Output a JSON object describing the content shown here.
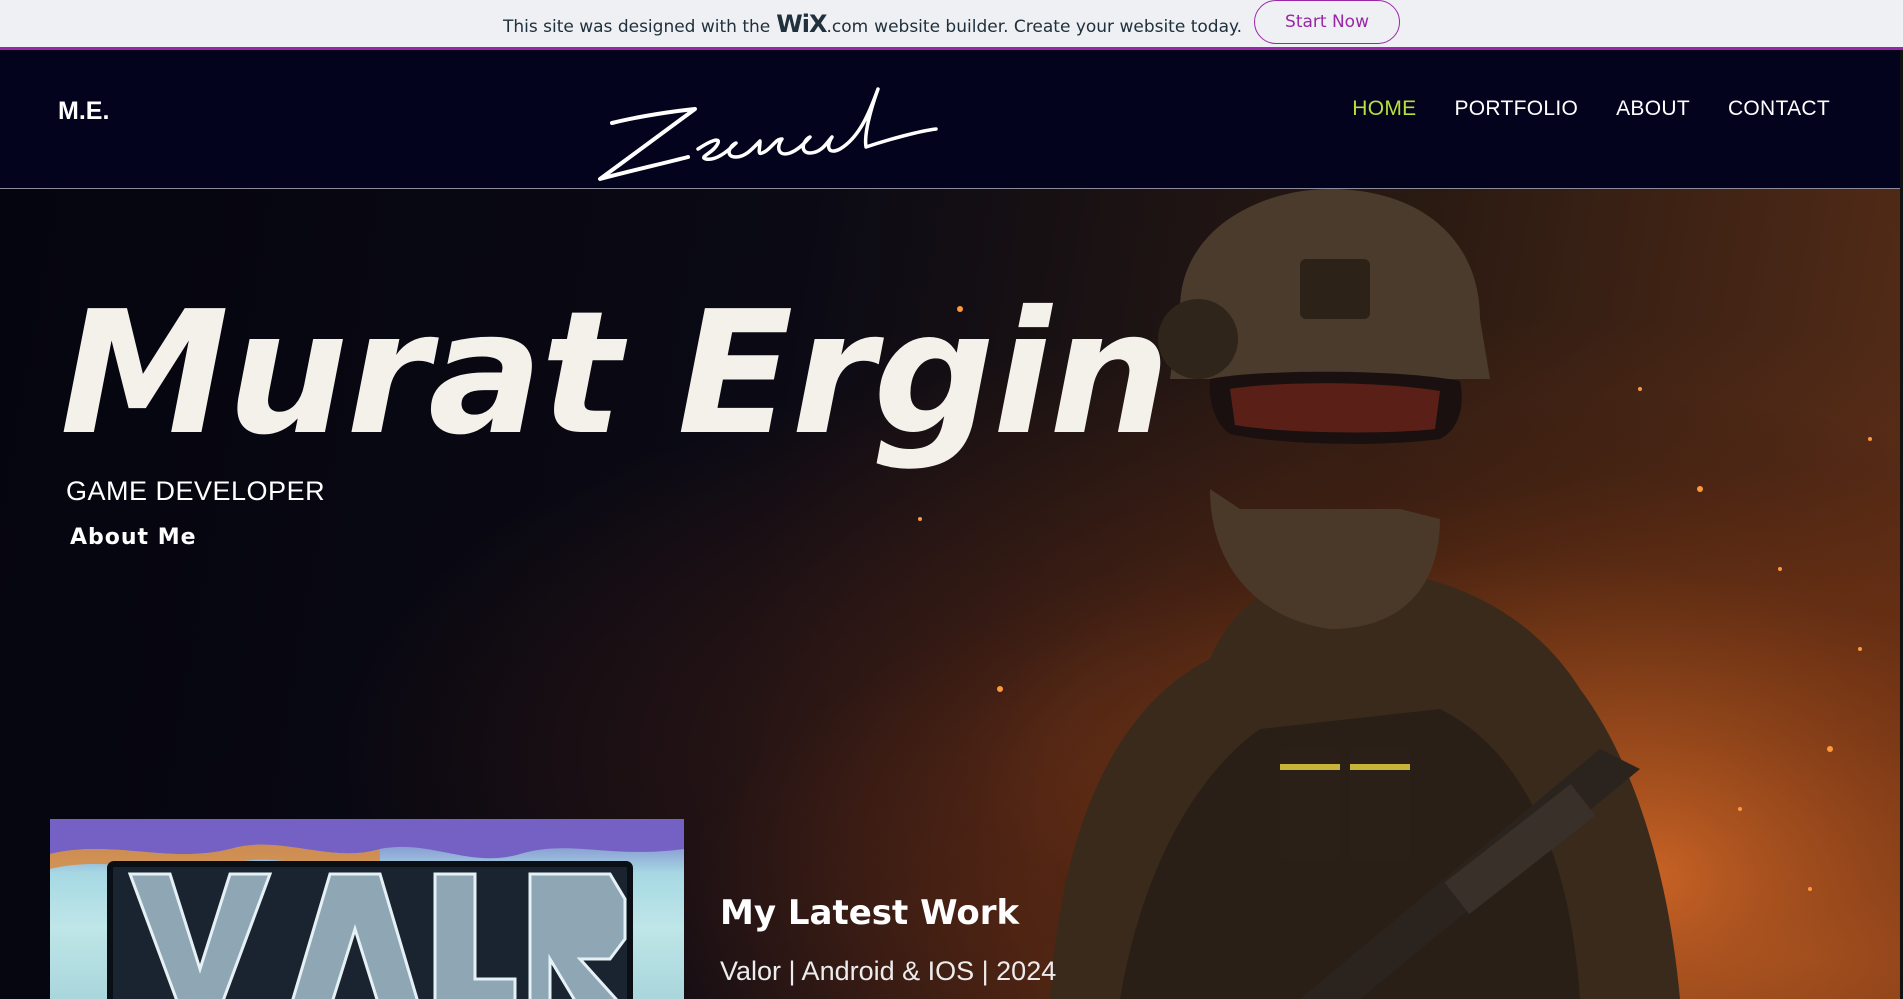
{
  "banner": {
    "text_before": "This site was designed with the",
    "logo": "WiX",
    "dotcom": ".com",
    "text_after": "website builder. Create your website today.",
    "button_label": "Start Now"
  },
  "header": {
    "brand": "M.E.",
    "signature": "Zecreal",
    "nav": [
      {
        "label": "HOME",
        "active": true
      },
      {
        "label": "PORTFOLIO",
        "active": false
      },
      {
        "label": "ABOUT",
        "active": false
      },
      {
        "label": "CONTACT",
        "active": false
      }
    ]
  },
  "hero": {
    "name": "Murat Ergin",
    "role": "GAME DEVELOPER",
    "about_link": "About Me"
  },
  "latest_work": {
    "heading": "My Latest Work",
    "meta": "Valor | Android & IOS | 2024",
    "thumbnail_text": "VALOR"
  },
  "colors": {
    "banner_accent": "#9a27a8",
    "header_bg": "#03031e",
    "nav_active": "#b7e03c",
    "hero_text": "#f4f1ea"
  }
}
